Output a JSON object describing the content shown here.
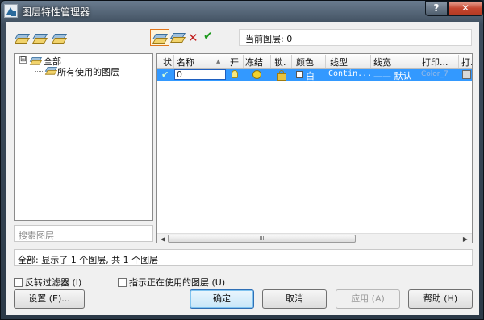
{
  "window": {
    "title": "图层特性管理器",
    "help_label": "?",
    "close_label": "✕"
  },
  "toolbar": {
    "current_layer_label": "当前图层: 0",
    "delete_symbol": "✕",
    "check_symbol": "✔"
  },
  "tree": {
    "expander": "⊟",
    "root_label": "全部",
    "child_label": "所有使用的图层"
  },
  "search": {
    "placeholder": "搜索图层"
  },
  "grid": {
    "columns": [
      "状.",
      "名称",
      "开",
      "冻结",
      "锁.",
      "颜色",
      "线型",
      "线宽",
      "打印...",
      "打."
    ],
    "sort_indicator": "▲",
    "rows": [
      {
        "status": "✔",
        "name": "0",
        "color": "白",
        "linetype": "Contin...",
        "lineweight": "—— 默认",
        "plot_style": "Color_7"
      }
    ],
    "scroll_left": "◀",
    "scroll_right": "▶",
    "scroll_grip": "III"
  },
  "status": {
    "text": "全部: 显示了 1 个图层, 共 1 个图层"
  },
  "options": {
    "invert_filter": "反转过滤器 (I)",
    "indicate_used": "指示正在使用的图层 (U)"
  },
  "buttons": {
    "settings": "设置 (E)...",
    "ok": "确定",
    "cancel": "取消",
    "apply": "应用 (A)",
    "help": "帮助 (H)"
  },
  "colors": {
    "selection": "#3399ff",
    "new_layer_highlight": "#e0761c",
    "delete": "#c21f1f",
    "check": "#1d9a1d"
  },
  "icons": [
    "app-icon",
    "new-property-filter-icon",
    "new-group-filter-icon",
    "layer-states-icon",
    "new-layer-icon",
    "new-layer-all-vp-frozen-icon",
    "delete-layer-icon",
    "set-current-icon"
  ]
}
